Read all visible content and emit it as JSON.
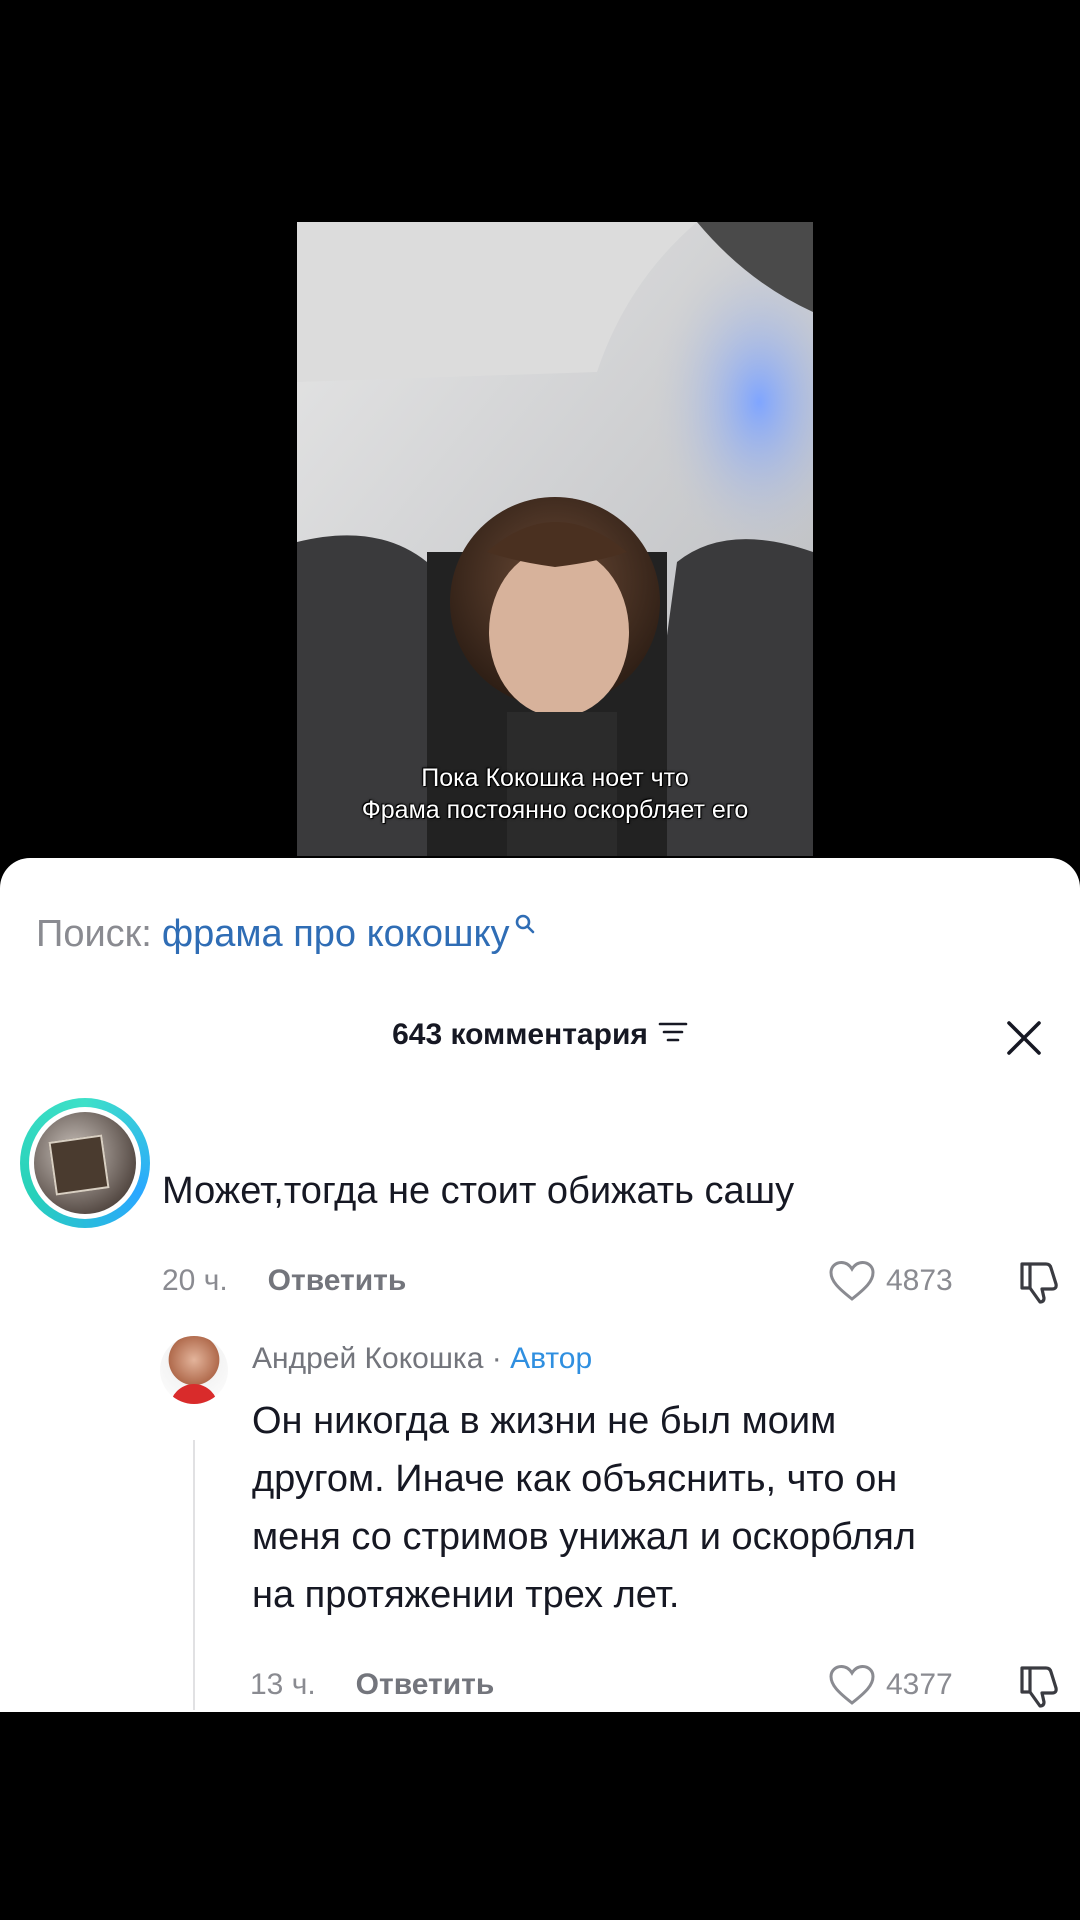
{
  "video": {
    "caption_lines": [
      "Пока Кокошка ноет что",
      "Фрама постоянно оскорбляет его"
    ]
  },
  "search": {
    "label": "Поиск:",
    "query": "фрама про кокошку",
    "icon": "search-icon"
  },
  "comments_header": {
    "count_label": "643 комментария",
    "sort_icon": "sort-icon",
    "close_icon": "close-icon"
  },
  "comment": {
    "text": "Может,тогда не стоит обижать сашу",
    "time": "20 ч.",
    "reply_label": "Ответить",
    "likes": "4873"
  },
  "reply": {
    "author": "Андрей Кокошка",
    "separator": "·",
    "badge": "Автор",
    "lines": [
      "Он никогда в жизни не был моим",
      "другом. Иначе как объяснить, что он",
      "меня со стримов унижал и оскорблял",
      "на протяжении трех лет."
    ],
    "time": "13 ч.",
    "reply_label": "Ответить",
    "likes": "4377"
  },
  "colors": {
    "accent_blue": "#2f6db5",
    "author_badge": "#2f8fe0",
    "muted": "#8a8b91"
  }
}
